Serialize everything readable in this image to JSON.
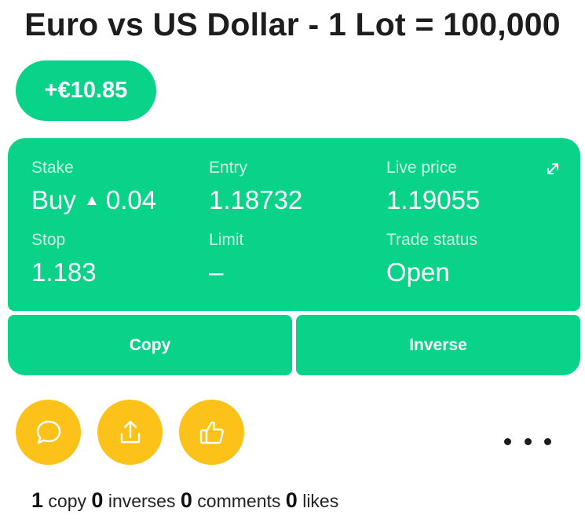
{
  "header": {
    "title": "Euro vs US Dollar - 1 Lot = 100,000"
  },
  "pnl": {
    "value": "+€10.85"
  },
  "trade": {
    "stake_label": "Stake",
    "direction": "Buy",
    "stake_value": "0.04",
    "entry_label": "Entry",
    "entry_value": "1.18732",
    "live_price_label": "Live price",
    "live_price_value": "1.19055",
    "stop_label": "Stop",
    "stop_value": "1.183",
    "limit_label": "Limit",
    "limit_value": "–",
    "status_label": "Trade status",
    "status_value": "Open"
  },
  "actions": {
    "copy_label": "Copy",
    "inverse_label": "Inverse"
  },
  "social": {
    "icons": [
      "comment-icon",
      "share-icon",
      "like-icon",
      "more-icon"
    ]
  },
  "stats": {
    "copies_count": "1",
    "copies_label": "copy",
    "inverses_count": "0",
    "inverses_label": "inverses",
    "comments_count": "0",
    "comments_label": "comments",
    "likes_count": "0",
    "likes_label": "likes"
  },
  "colors": {
    "accent_green": "#08d389",
    "accent_yellow": "#fcc219",
    "text_dark": "#1c1c1c"
  }
}
